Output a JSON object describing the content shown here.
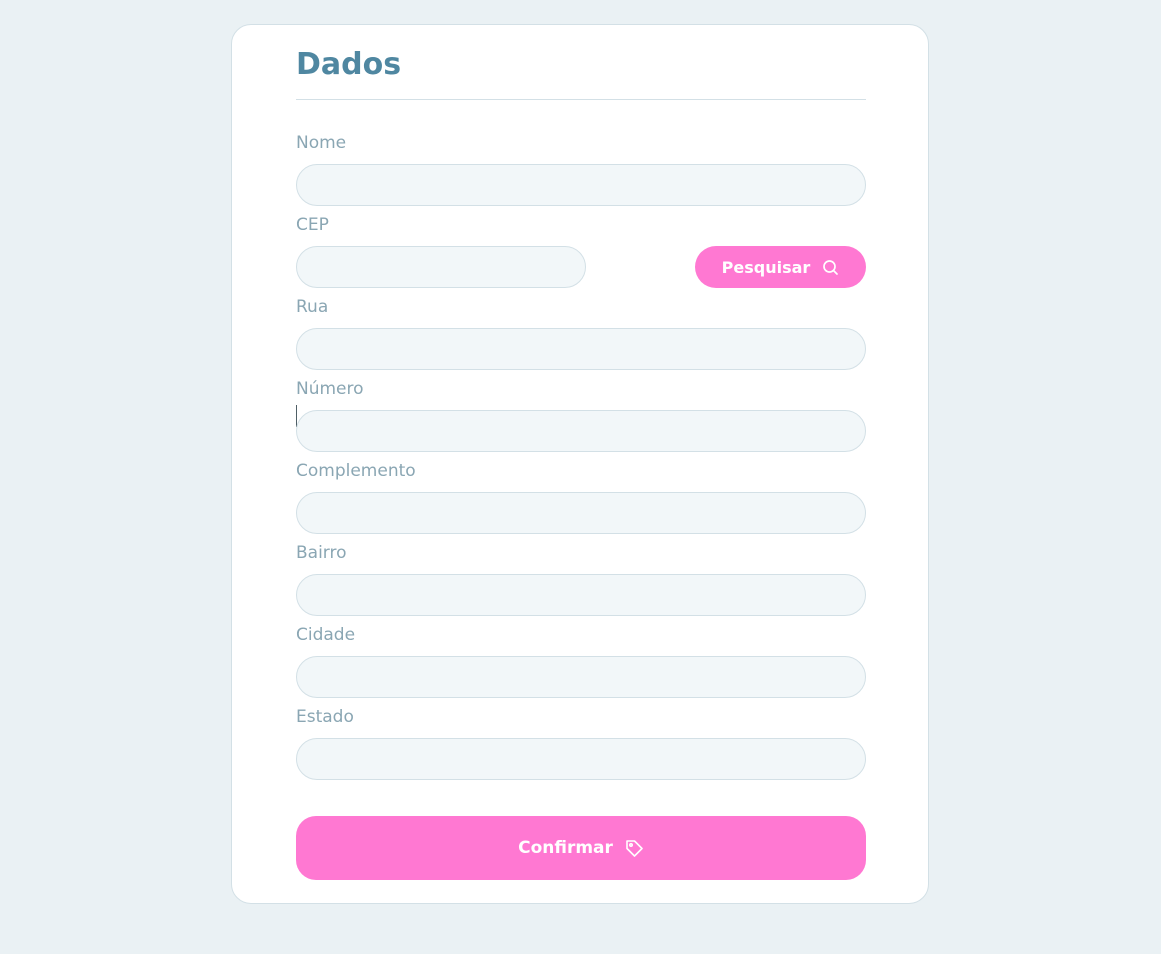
{
  "form": {
    "title": "Dados",
    "fields": {
      "nome": {
        "label": "Nome",
        "value": ""
      },
      "cep": {
        "label": "CEP",
        "value": ""
      },
      "rua": {
        "label": "Rua",
        "value": ""
      },
      "numero": {
        "label": "Número",
        "value": ""
      },
      "complemento": {
        "label": "Complemento",
        "value": ""
      },
      "bairro": {
        "label": "Bairro",
        "value": ""
      },
      "cidade": {
        "label": "Cidade",
        "value": ""
      },
      "estado": {
        "label": "Estado",
        "value": ""
      }
    },
    "search_button": {
      "label": "Pesquisar",
      "icon": "search-icon"
    },
    "confirm_button": {
      "label": "Confirmar",
      "icon": "tag-icon"
    }
  },
  "colors": {
    "background": "#eaf1f4",
    "card": "#ffffff",
    "title": "#4f87a1",
    "label": "#8aa6b3",
    "input_bg": "#f2f7f9",
    "border": "#d3e0e6",
    "accent": "#ff78d2"
  }
}
